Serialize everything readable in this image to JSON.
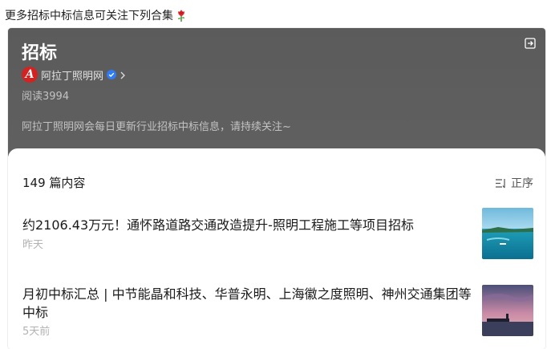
{
  "intro_text": "更多招标中标信息可关注下列合集",
  "header": {
    "title": "招标",
    "account_name": "阿拉丁照明网",
    "reads": "阅读3994",
    "description": "阿拉丁照明网会每日更新行业招标中标信息，请持续关注~"
  },
  "list": {
    "count": "149 篇内容",
    "sort_label": "正序"
  },
  "articles": [
    {
      "title": "约2106.43万元！通怀路道路交通改造提升-照明工程施工等项目招标",
      "time": "昨天"
    },
    {
      "title": "月初中标汇总 | 中节能晶和科技、华普永明、上海徽之度照明、神州交通集团等中标",
      "time": "5天前"
    }
  ],
  "colors": {
    "header_bg": "#5e5e5e",
    "logo_red": "#d32222",
    "verified_blue": "#2f7bf5",
    "muted_text": "#b2b2b2"
  }
}
